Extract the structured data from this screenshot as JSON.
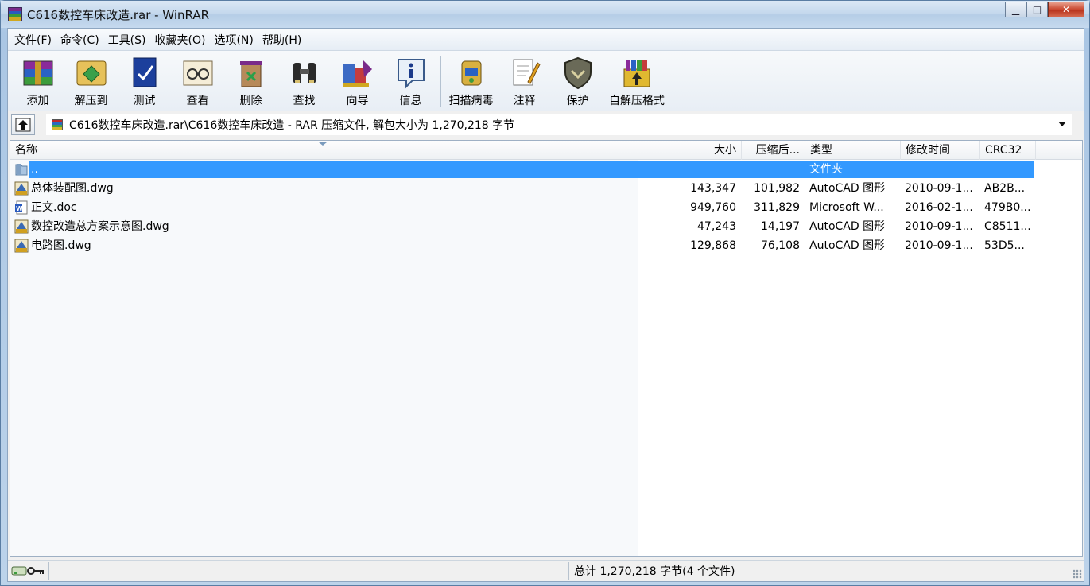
{
  "window": {
    "title": "C616数控车床改造.rar - WinRAR",
    "controls": {
      "minimize": "▁",
      "maximize": "□",
      "close": "✕"
    }
  },
  "menu": [
    "文件(F)",
    "命令(C)",
    "工具(S)",
    "收藏夹(O)",
    "选项(N)",
    "帮助(H)"
  ],
  "toolbar": [
    {
      "label": "添加",
      "icon": "add-archive-icon"
    },
    {
      "label": "解压到",
      "icon": "extract-to-icon"
    },
    {
      "label": "测试",
      "icon": "test-icon"
    },
    {
      "label": "查看",
      "icon": "view-icon"
    },
    {
      "label": "删除",
      "icon": "delete-icon"
    },
    {
      "label": "查找",
      "icon": "find-icon"
    },
    {
      "label": "向导",
      "icon": "wizard-icon"
    },
    {
      "label": "信息",
      "icon": "info-icon"
    },
    {
      "label": "扫描病毒",
      "icon": "virus-scan-icon"
    },
    {
      "label": "注释",
      "icon": "comment-icon"
    },
    {
      "label": "保护",
      "icon": "protect-icon"
    },
    {
      "label": "自解压格式",
      "icon": "sfx-icon"
    }
  ],
  "address": {
    "path": "C616数控车床改造.rar\\C616数控车床改造 - RAR 压缩文件, 解包大小为 1,270,218 字节"
  },
  "columns": {
    "name": "名称",
    "size": "大小",
    "packed": "压缩后...",
    "type": "类型",
    "modified": "修改时间",
    "crc": "CRC32"
  },
  "files": [
    {
      "name": "..",
      "size": "",
      "packed": "",
      "type": "文件夹",
      "modified": "",
      "crc": "",
      "icon": "folder-icon",
      "selected": true
    },
    {
      "name": "总体装配图.dwg",
      "size": "143,347",
      "packed": "101,982",
      "type": "AutoCAD 图形",
      "modified": "2010-09-1...",
      "crc": "AB2B...",
      "icon": "dwg-file-icon"
    },
    {
      "name": "正文.doc",
      "size": "949,760",
      "packed": "311,829",
      "type": "Microsoft W...",
      "modified": "2016-02-1...",
      "crc": "479B0...",
      "icon": "word-doc-icon"
    },
    {
      "name": "数控改造总方案示意图.dwg",
      "size": "47,243",
      "packed": "14,197",
      "type": "AutoCAD 图形",
      "modified": "2010-09-1...",
      "crc": "C8511...",
      "icon": "dwg-file-icon"
    },
    {
      "name": "电路图.dwg",
      "size": "129,868",
      "packed": "76,108",
      "type": "AutoCAD 图形",
      "modified": "2010-09-1...",
      "crc": "53D5...",
      "icon": "dwg-file-icon"
    }
  ],
  "status": {
    "summary": "总计 1,270,218 字节(4 个文件)"
  }
}
